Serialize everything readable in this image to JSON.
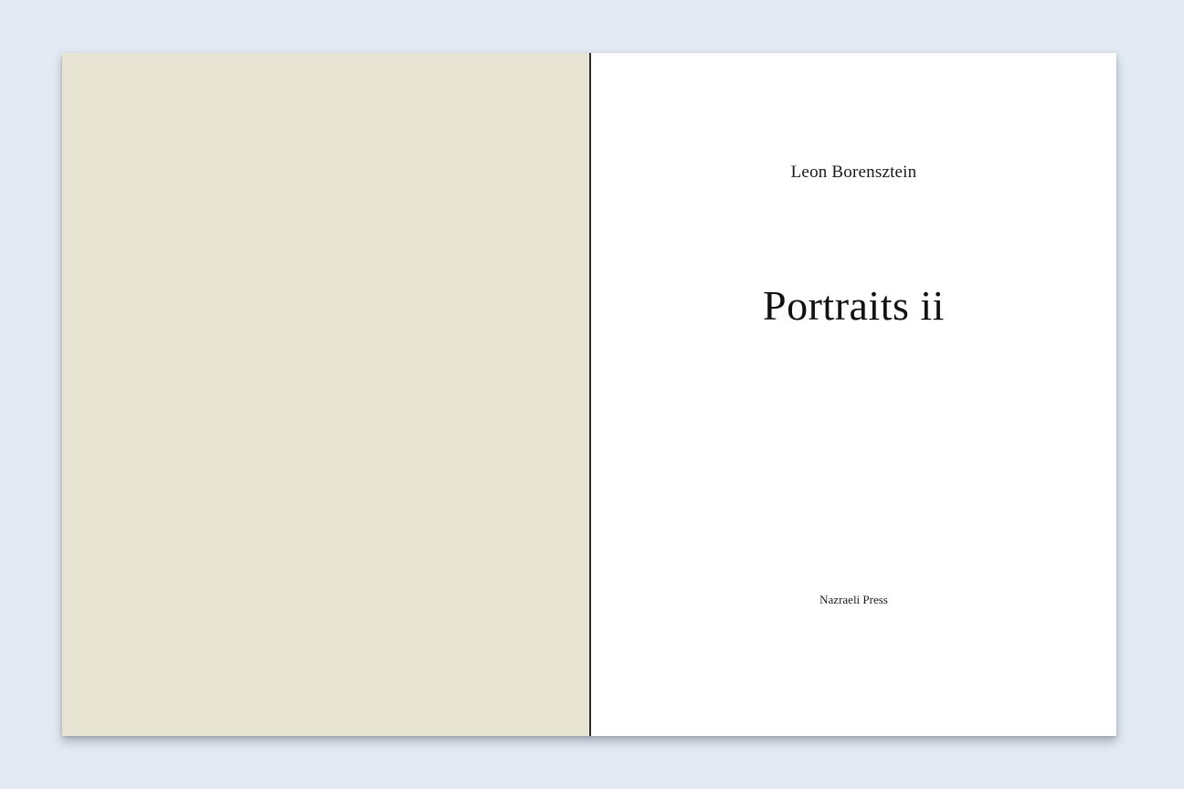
{
  "book": {
    "author": "Leon Borensztein",
    "title": "Portraits ii",
    "publisher": "Nazraeli Press"
  },
  "colors": {
    "background": "#e3eaf3",
    "left_page": "#e7e4d3",
    "right_page": "#ffffff",
    "gutter": "#2b2b2b",
    "text": "#1a1a1a"
  }
}
